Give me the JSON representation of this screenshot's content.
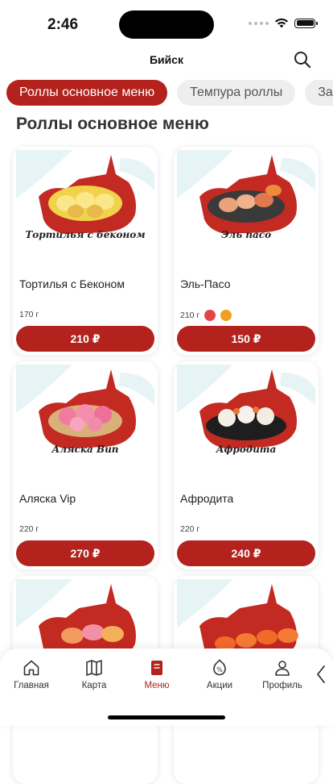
{
  "status_bar": {
    "time": "2:46"
  },
  "header": {
    "city": "Бийск",
    "search_icon": "search-icon"
  },
  "category_tabs": [
    {
      "label": "Роллы основное меню",
      "active": true
    },
    {
      "label": "Темпура роллы",
      "active": false
    },
    {
      "label": "Запеченные роллы",
      "active": false
    }
  ],
  "section": {
    "title": "Роллы основное меню"
  },
  "products": [
    {
      "name": "Тортилья с Беконом",
      "caption": "Тортилья с беконом",
      "weight": "170 г",
      "price": "210 ₽",
      "badges": []
    },
    {
      "name": "Эль-Пасо",
      "caption": "Эль пасо",
      "weight": "210 г",
      "price": "150 ₽",
      "badges": [
        "#e0464a",
        "#f0a020"
      ]
    },
    {
      "name": "Аляска Vip",
      "caption": "Аляска Вип",
      "weight": "220 г",
      "price": "270 ₽",
      "badges": []
    },
    {
      "name": "Афродита",
      "caption": "Афродита",
      "weight": "220 г",
      "price": "240 ₽",
      "badges": []
    },
    {
      "name": "",
      "caption": "",
      "weight": "",
      "price": "",
      "badges": []
    },
    {
      "name": "",
      "caption": "",
      "weight": "",
      "price": "",
      "badges": []
    }
  ],
  "tab_bar": {
    "items": [
      {
        "label": "Главная",
        "icon": "home-icon",
        "active": false
      },
      {
        "label": "Карта",
        "icon": "map-icon",
        "active": false
      },
      {
        "label": "Меню",
        "icon": "menu-book-icon",
        "active": true
      },
      {
        "label": "Акции",
        "icon": "discount-icon",
        "active": false
      },
      {
        "label": "Профиль",
        "icon": "profile-icon",
        "active": false
      }
    ],
    "more_icon": "chevron-left-icon"
  },
  "colors": {
    "accent": "#b3221c",
    "tab_inactive": "#eeeeee",
    "text": "#222222"
  }
}
